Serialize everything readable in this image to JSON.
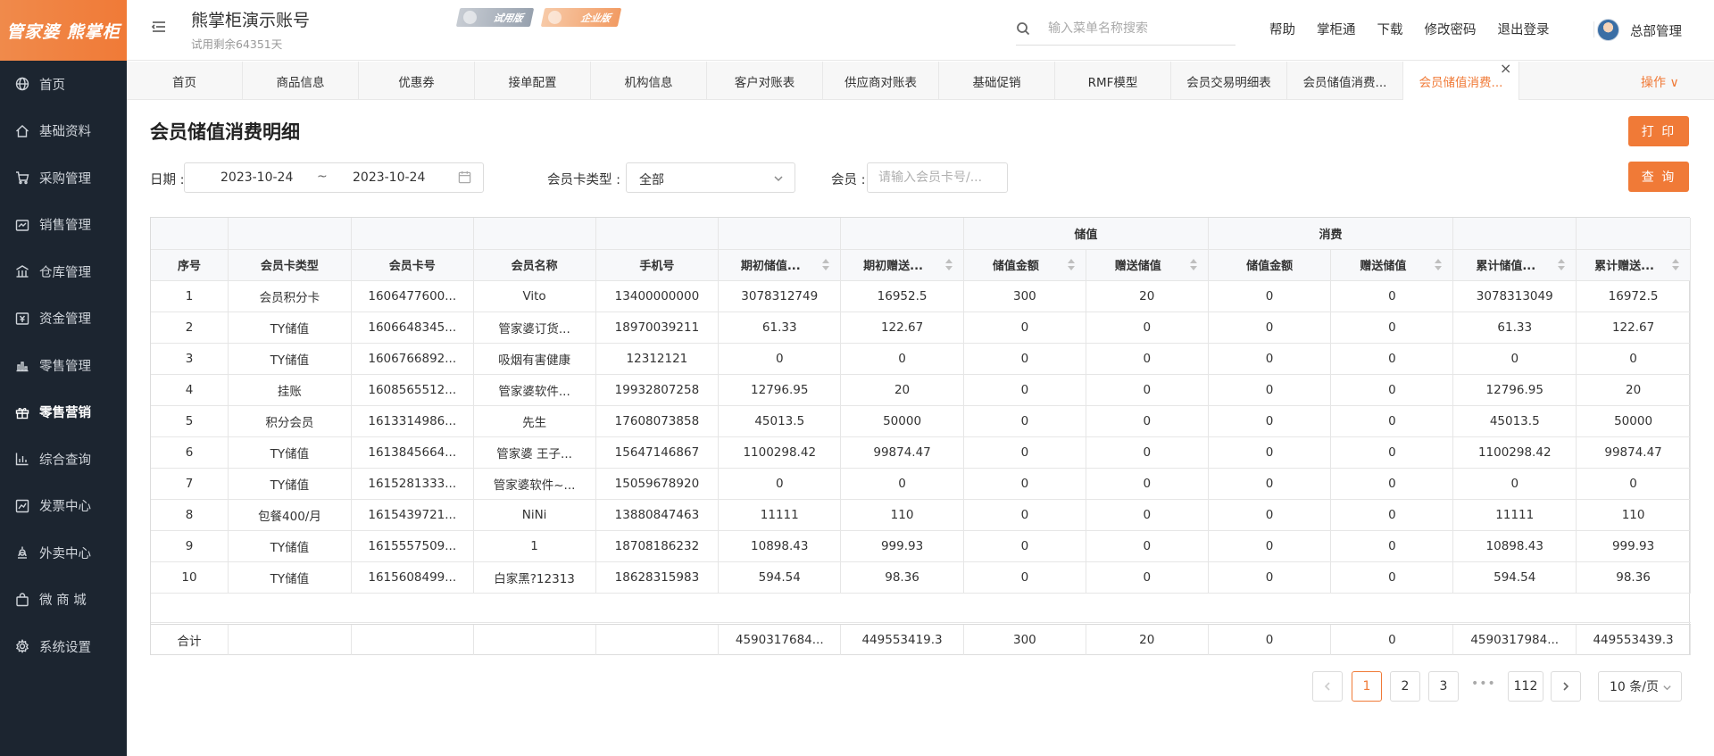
{
  "brand": {
    "logo_text": "管家婆 熊掌柜",
    "accent": "#f07a37",
    "sidebar_bg": "#1c2530"
  },
  "sidebar": {
    "items": [
      {
        "label": "首页",
        "icon": "globe-icon"
      },
      {
        "label": "基础资料",
        "icon": "home-icon"
      },
      {
        "label": "采购管理",
        "icon": "cart-icon"
      },
      {
        "label": "销售管理",
        "icon": "sales-icon"
      },
      {
        "label": "仓库管理",
        "icon": "warehouse-icon"
      },
      {
        "label": "资金管理",
        "icon": "money-icon"
      },
      {
        "label": "零售管理",
        "icon": "chart-icon"
      },
      {
        "label": "零售营销",
        "icon": "gift-icon"
      },
      {
        "label": "综合查询",
        "icon": "bar-chart-icon"
      },
      {
        "label": "发票中心",
        "icon": "line-chart-icon"
      },
      {
        "label": "外卖中心",
        "icon": "delivery-icon"
      },
      {
        "label": "微 商 城",
        "icon": "bag-icon"
      },
      {
        "label": "系统设置",
        "icon": "gear-icon"
      }
    ],
    "active_index": 7
  },
  "header": {
    "account_name": "熊掌柜演示账号",
    "trial_badge": "试用版",
    "enterprise_badge": "企业版",
    "trial_remaining": "试用剩余64351天",
    "search_placeholder": "输入菜单名称搜索",
    "links": [
      "帮助",
      "掌柜通",
      "下载",
      "修改密码",
      "退出登录"
    ],
    "user_name": "总部管理"
  },
  "tabs": {
    "items": [
      "首页",
      "商品信息",
      "优惠券",
      "接单配置",
      "机构信息",
      "客户对账表",
      "供应商对账表",
      "基础促销",
      "RMF模型",
      "会员交易明细表",
      "会员储值消费...",
      "会员储值消费..."
    ],
    "active_index": 11,
    "close": "×",
    "operations": "操作 ∨"
  },
  "page": {
    "title": "会员储值消费明细",
    "print_label": "打 印",
    "query_label": "查 询"
  },
  "filters": {
    "date_label": "日期 :",
    "date_from": "2023-10-24",
    "date_sep": "~",
    "date_to": "2023-10-24",
    "card_type_label": "会员卡类型 :",
    "card_type_value": "全部",
    "member_label": "会员 :",
    "member_placeholder": "请输入会员卡号/..."
  },
  "table": {
    "group_headers": {
      "stored": "储值",
      "consume": "消费"
    },
    "columns": [
      "序号",
      "会员卡类型",
      "会员卡号",
      "会员名称",
      "手机号",
      "期初储值...",
      "期初赠送...",
      "储值金额",
      "赠送储值",
      "储值金额",
      "赠送储值",
      "累计储值...",
      "累计赠送..."
    ],
    "rows": [
      [
        "1",
        "会员积分卡",
        "1606477600...",
        "Vito",
        "13400000000",
        "3078312749",
        "16952.5",
        "300",
        "20",
        "0",
        "0",
        "3078313049",
        "16972.5"
      ],
      [
        "2",
        "TY储值",
        "1606648345...",
        "管家婆订货...",
        "18970039211",
        "61.33",
        "122.67",
        "0",
        "0",
        "0",
        "0",
        "61.33",
        "122.67"
      ],
      [
        "3",
        "TY储值",
        "1606766892...",
        "吸烟有害健康",
        "12312121",
        "0",
        "0",
        "0",
        "0",
        "0",
        "0",
        "0",
        "0"
      ],
      [
        "4",
        "挂账",
        "1608565512...",
        "管家婆软件...",
        "19932807258",
        "12796.95",
        "20",
        "0",
        "0",
        "0",
        "0",
        "12796.95",
        "20"
      ],
      [
        "5",
        "积分会员",
        "1613314986...",
        "先生",
        "17608073858",
        "45013.5",
        "50000",
        "0",
        "0",
        "0",
        "0",
        "45013.5",
        "50000"
      ],
      [
        "6",
        "TY储值",
        "1613845664...",
        "管家婆 王子...",
        "15647146867",
        "1100298.42",
        "99874.47",
        "0",
        "0",
        "0",
        "0",
        "1100298.42",
        "99874.47"
      ],
      [
        "7",
        "TY储值",
        "1615281333...",
        "管家婆软件~...",
        "15059678920",
        "0",
        "0",
        "0",
        "0",
        "0",
        "0",
        "0",
        "0"
      ],
      [
        "8",
        "包餐400/月",
        "1615439721...",
        "NiNi",
        "13880847463",
        "11111",
        "110",
        "0",
        "0",
        "0",
        "0",
        "11111",
        "110"
      ],
      [
        "9",
        "TY储值",
        "1615557509...",
        "1",
        "18708186232",
        "10898.43",
        "999.93",
        "0",
        "0",
        "0",
        "0",
        "10898.43",
        "999.93"
      ],
      [
        "10",
        "TY储值",
        "1615608499...",
        "白家黑?12313",
        "18628315983",
        "594.54",
        "98.36",
        "0",
        "0",
        "0",
        "0",
        "594.54",
        "98.36"
      ]
    ],
    "total": [
      "合计",
      "",
      "",
      "",
      "",
      "4590317684...",
      "449553419.3",
      "300",
      "20",
      "0",
      "0",
      "4590317984...",
      "449553439.3"
    ]
  },
  "pagination": {
    "pages": [
      "1",
      "2",
      "3"
    ],
    "active": "1",
    "ellipsis": "•••",
    "last": "112",
    "page_size": "10 条/页"
  }
}
